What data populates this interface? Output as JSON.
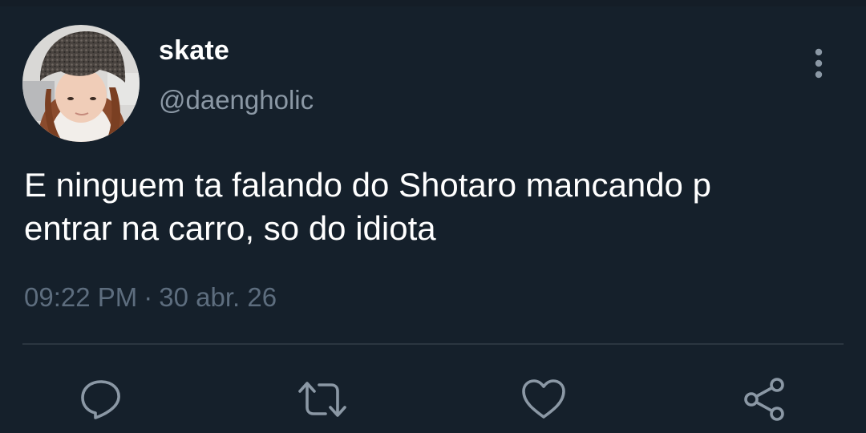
{
  "colors": {
    "background": "#15202b",
    "primary_text": "#ffffff",
    "secondary_text": "#8b98a5",
    "meta_text": "#5d6d7e",
    "icon": "#8b98a5",
    "divider": "#2b3640"
  },
  "author": {
    "display_name": "skate",
    "handle": "@daengholic",
    "avatar_icon": "avatar-photo"
  },
  "tweet": {
    "text": "E ninguem ta falando do Shotaro mancando p\nentrar na carro, so do idiota",
    "time": "09:22 PM",
    "separator": "·",
    "date": "30 abr. 26"
  },
  "actions": [
    {
      "icon": "reply-icon"
    },
    {
      "icon": "retweet-icon"
    },
    {
      "icon": "like-icon"
    },
    {
      "icon": "share-icon"
    }
  ],
  "menu": {
    "icon": "more-vertical-icon"
  }
}
